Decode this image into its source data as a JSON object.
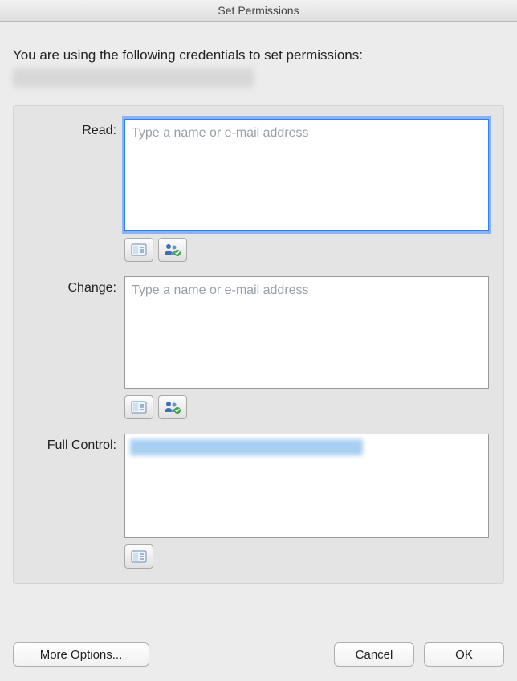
{
  "dialog": {
    "title": "Set Permissions",
    "intro": "You are using the following credentials to set permissions:"
  },
  "permissions": [
    {
      "key": "read",
      "label": "Read:",
      "placeholder": "Type a name or e-mail address",
      "value": "",
      "focused": true,
      "has_check_names": true
    },
    {
      "key": "change",
      "label": "Change:",
      "placeholder": "Type a name or e-mail address",
      "value": "",
      "focused": false,
      "has_check_names": true
    },
    {
      "key": "full_control",
      "label": "Full Control:",
      "placeholder": "",
      "value": "",
      "focused": false,
      "has_check_names": false
    }
  ],
  "buttons": {
    "more_options": "More Options...",
    "cancel": "Cancel",
    "ok": "OK"
  }
}
